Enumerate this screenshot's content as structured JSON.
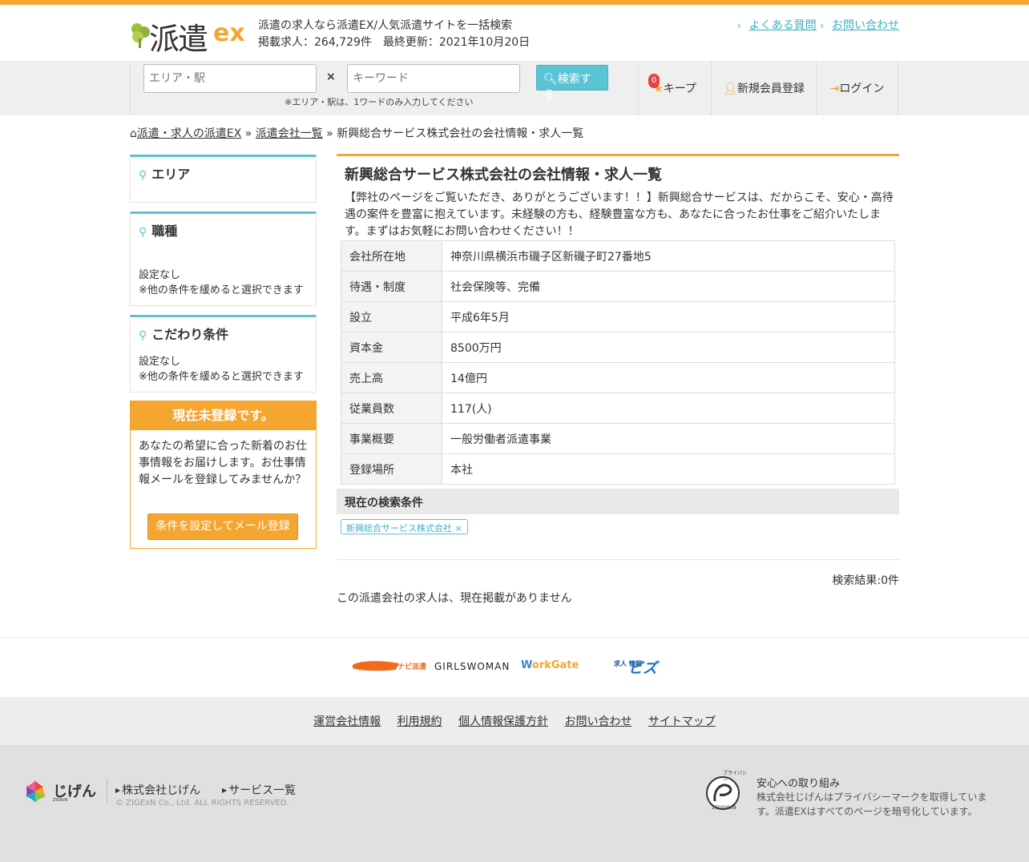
{
  "header": {
    "logo_text": "派遣",
    "logo_ex": "ex",
    "tagline": "派遣の求人なら派遣EX/人気派遣サイトを一括検索",
    "stats": "掲載求人：264,729件　最終更新：2021年10月20日",
    "links": [
      "よくある質問",
      "お問い合わせ"
    ]
  },
  "search": {
    "area_placeholder": "エリア・駅",
    "keyword_placeholder": "キーワード",
    "times": "×",
    "button": "検索する",
    "note": "※エリア・駅は、1ワードのみ入力してください"
  },
  "nav": {
    "keep_count": "0",
    "keep": "キープ",
    "register": "新規会員登録",
    "login": "ログイン"
  },
  "breadcrumb": {
    "home": "派遣・求人の派遣EX",
    "sep": "»",
    "list": "派遣会社一覧",
    "current": "新興総合サービス株式会社の会社情報・求人一覧"
  },
  "sidebar": {
    "area_title": "エリア",
    "job_title": "職種",
    "job_note1": "設定なし",
    "job_note2": "※他の条件を緩めると選択できます",
    "pref_title": "こだわり条件",
    "pref_note1": "設定なし",
    "pref_note2": "※他の条件を緩めると選択できます",
    "reg_head": "現在未登録です。",
    "reg_text": "あなたの希望に合った新着のお仕事情報をお届けします。お仕事情報メールを登録してみませんか？",
    "reg_button": "条件を設定してメール登録"
  },
  "main": {
    "title": "新興総合サービス株式会社の会社情報・求人一覧",
    "description": "【弊社のページをご覧いただき、ありがとうございます！！】新興総合サービスは、だからこそ、安心・高待遇の案件を豊富に抱えています。未経験の方も、経験豊富な方も、あなたに合ったお仕事をご紹介いたします。まずはお気軽にお問い合わせください！！",
    "info": [
      {
        "label": "会社所在地",
        "value": "神奈川県横浜市磯子区新磯子町27番地5"
      },
      {
        "label": "待遇・制度",
        "value": "社会保険等、完備"
      },
      {
        "label": "設立",
        "value": "平成6年5月"
      },
      {
        "label": "資本金",
        "value": "8500万円"
      },
      {
        "label": "売上高",
        "value": "14億円"
      },
      {
        "label": "従業員数",
        "value": "117(人)"
      },
      {
        "label": "事業概要",
        "value": "一般労働者派遣事業"
      },
      {
        "label": "登録場所",
        "value": "本社"
      }
    ],
    "cond_head": "現在の検索条件",
    "cond_tag": "新興総合サービス株式会社 ×",
    "result_count": "検索結果:0件",
    "no_jobs": "この派遣会社の求人は、現在掲載がありません"
  },
  "partners": {
    "rikunabi": "リクナビ派遣",
    "girlswoman": "GIRLSWOMAN",
    "workgate_w": "W",
    "workgate": "orkGate",
    "biz_small": "求人 情報",
    "biz": "ビズ"
  },
  "footer_links": [
    "運営会社情報",
    "利用規約",
    "個人情報保護方針",
    "お問い合わせ",
    "サイトマップ"
  ],
  "footer": {
    "company_logo": "じげん",
    "company_logo_sub": "ZIGExN",
    "link_company": "株式会社じげん",
    "link_services": "サービス一覧",
    "copyright": "© ZIGExN Co., Ltd. ALL RIGHTS RESERVED.",
    "pmark_number": "17000569",
    "pmark_text": "プライバシー",
    "safety_title": "安心への取り組み",
    "safety_text": "株式会社じげんはプライバシーマークを取得しています。派遣EXはすべてのページを暗号化しています。"
  },
  "colors": {
    "accent": "#f5a631",
    "teal": "#5bc4d4",
    "link": "#3eb0c2"
  }
}
